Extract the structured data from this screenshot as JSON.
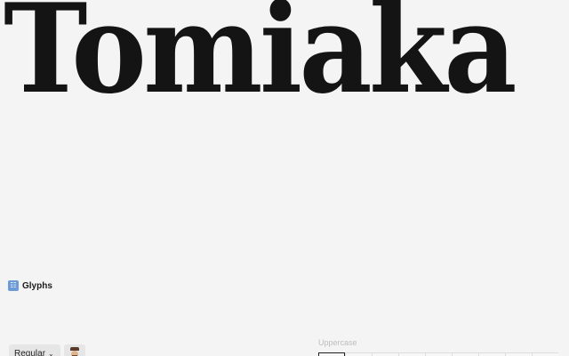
{
  "hero": {
    "specimen_text": "Tomiaka"
  },
  "glyphs_section": {
    "icon": "glyphs-icon",
    "icon_glyph": "☷",
    "title": "Glyphs"
  },
  "toolbar": {
    "style_select": {
      "value": "Regular",
      "chevron": "⌄"
    },
    "avatar_icon": "avatar-icon"
  },
  "glyph_table": {
    "category": "Uppercase",
    "visible_cells": 9,
    "selected_index": 0
  }
}
